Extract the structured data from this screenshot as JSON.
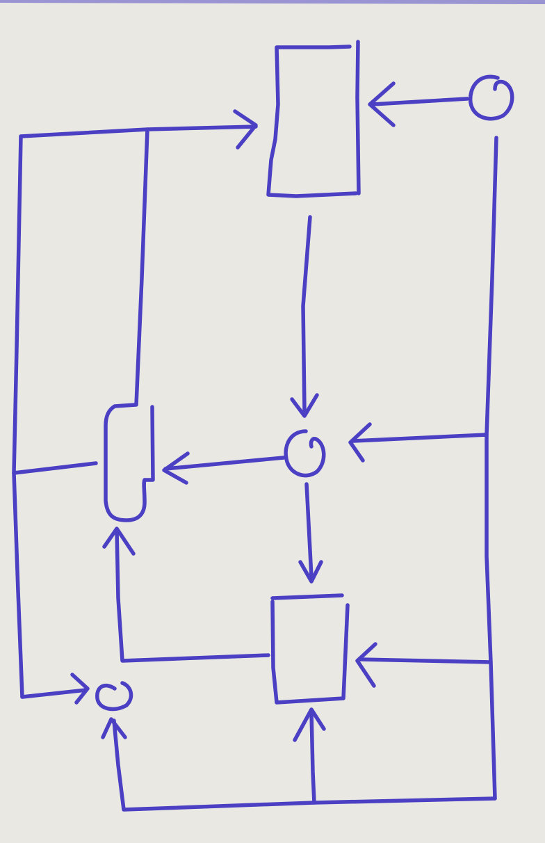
{
  "diagram": {
    "kind": "hand-drawn block diagram",
    "ink_color": "#4b3fc4",
    "paper_color": "#e9e8e2",
    "nodes": [
      {
        "id": "block-top",
        "shape": "rectangle"
      },
      {
        "id": "block-bottom",
        "shape": "rectangle"
      },
      {
        "id": "block-left",
        "shape": "rounded-rectangle"
      },
      {
        "id": "circle-top-right",
        "shape": "circle"
      },
      {
        "id": "circle-center",
        "shape": "circle"
      },
      {
        "id": "circle-bottom-left",
        "shape": "circle"
      }
    ],
    "edges": [
      {
        "from": "circle-top-right",
        "to": "block-top"
      },
      {
        "from": "block-top",
        "to": "circle-center"
      },
      {
        "from": "circle-top-right",
        "to": "circle-center"
      },
      {
        "from": "circle-center",
        "to": "block-left"
      },
      {
        "from": "circle-center",
        "to": "block-bottom"
      },
      {
        "from": "circle-top-right",
        "to": "block-bottom"
      },
      {
        "from": "block-bottom",
        "to": "block-left"
      },
      {
        "from": "block-left",
        "to": "block-top"
      },
      {
        "from": "block-left",
        "to": "circle-bottom-left"
      },
      {
        "from": "circle-top-right",
        "to": "circle-bottom-left"
      }
    ]
  }
}
